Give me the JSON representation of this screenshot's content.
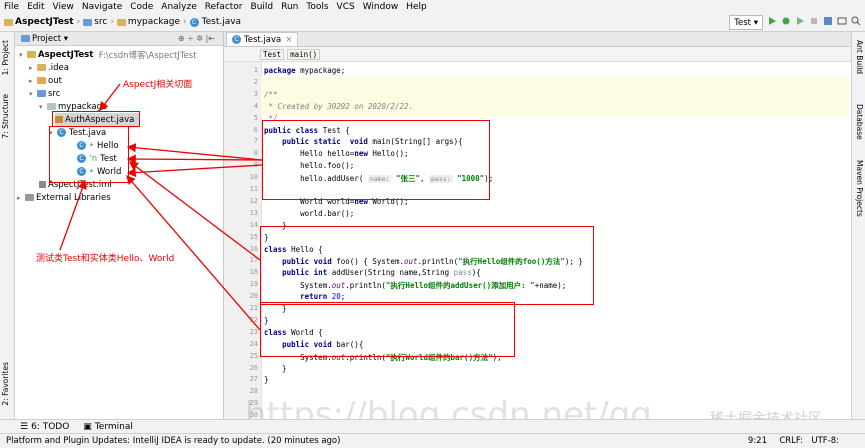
{
  "menu": [
    "File",
    "Edit",
    "View",
    "Navigate",
    "Code",
    "Analyze",
    "Refactor",
    "Build",
    "Run",
    "Tools",
    "VCS",
    "Window",
    "Help"
  ],
  "breadcrumb": {
    "project": "AspectJTest",
    "src": "src",
    "pkg": "mypackage",
    "file": "Test.java"
  },
  "run_config": "Test",
  "sidebar_left": {
    "project": "1: Project",
    "structure": "7: Structure",
    "favorites": "2: Favorites"
  },
  "sidebar_right": {
    "ant": "Ant Build",
    "database": "Database",
    "maven": "Maven Projects"
  },
  "project_panel": {
    "title": "Project",
    "root_name": "AspectJTest",
    "root_path": "F:\\csdn博客\\AspectJTest",
    "idea": ".idea",
    "out": "out",
    "src": "src",
    "mypackage": "mypackage",
    "authaspect": "AuthAspect.java",
    "testjava": "Test.java",
    "hello": "Hello",
    "test": "Test",
    "world": "World",
    "iml": "AspectJTest.iml",
    "extlib": "External Libraries"
  },
  "editor": {
    "tab": "Test.java",
    "crumbs": [
      "Test",
      "main()"
    ],
    "line_numbers": [
      "1",
      "2",
      "3",
      "4",
      "5",
      "6",
      "7",
      "8",
      "9",
      "10",
      "11",
      "12",
      "13",
      "14",
      "15",
      "16",
      "17",
      "18",
      "19",
      "20",
      "21",
      "22",
      "23",
      "24",
      "25",
      "26",
      "27",
      "28",
      "29",
      "30"
    ]
  },
  "annotations": {
    "aspect": "AspectJ相关切面",
    "classes": "测试类Test和实体类Hello、World"
  },
  "bottom_tabs": {
    "todo": "6: TODO",
    "terminal": "Terminal"
  },
  "status": {
    "message": "Platform and Plugin Updates: IntelliJ IDEA is ready to update. (20 minutes ago)",
    "pos": "9:21",
    "crlf": "CRLF:",
    "enc": "UTF-8:"
  },
  "watermark": {
    "url": "https://blog.csdn.net/qq_",
    "site": "稀土掘金技术社区"
  },
  "colors": {
    "red": "#e00000",
    "keyword": "#000080",
    "string": "#008000"
  }
}
